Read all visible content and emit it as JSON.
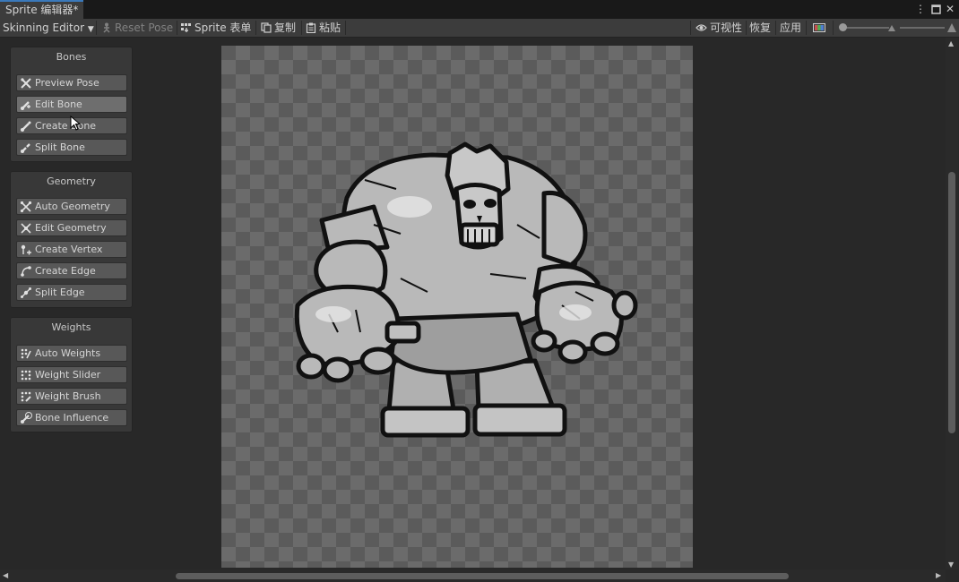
{
  "window": {
    "tab_title": "Sprite 编辑器*",
    "controls": [
      "more-icon",
      "maximize-icon",
      "close-icon"
    ]
  },
  "toolbar": {
    "mode_dropdown": "Skinning Editor",
    "reset_pose": "Reset Pose",
    "sprite_sheet": "Sprite 表单",
    "copy": "复制",
    "paste": "粘贴",
    "visibility": "可视性",
    "revert": "恢复",
    "apply": "应用",
    "zoom_slider_value": 0.0
  },
  "bones": {
    "title": "Bones",
    "preview_pose": "Preview Pose",
    "edit_bone": "Edit Bone",
    "create_bone": "Create Bone",
    "split_bone": "Split Bone"
  },
  "geometry": {
    "title": "Geometry",
    "auto_geometry": "Auto Geometry",
    "edit_geometry": "Edit Geometry",
    "create_vertex": "Create Vertex",
    "create_edge": "Create Edge",
    "split_edge": "Split Edge"
  },
  "weights": {
    "title": "Weights",
    "auto_weights": "Auto Weights",
    "weight_slider": "Weight Slider",
    "weight_brush": "Weight Brush",
    "bone_influence": "Bone Influence"
  },
  "colors": {
    "accent": "#3a79bb",
    "background": "#282828",
    "panel": "#383838",
    "button": "#585858"
  }
}
